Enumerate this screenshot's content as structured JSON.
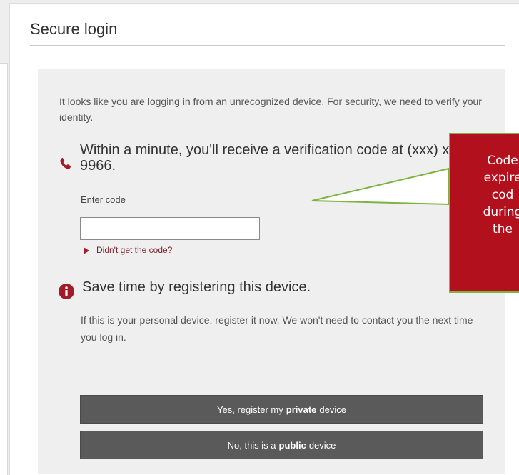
{
  "login": {
    "title": "Secure login",
    "intro": "It looks like you are logging in from an unrecognized device. For security, we need to verify your identity.",
    "verify_heading": "Within a minute, you'll receive a verification code at (xxx) xxx-9966.",
    "enter_code_label": "Enter code",
    "code_value": "",
    "didnt_get_code": "Didn't get the code?",
    "save_heading": "Save time by registering this device.",
    "save_text": "If this is your personal device, register it now. We won't need to contact you the next time you log in.",
    "btn_private_pre": "Yes, register my",
    "btn_private_bold": "private",
    "btn_private_post": "device",
    "btn_public_pre": "No, this is a",
    "btn_public_bold": "public",
    "btn_public_post": "device"
  },
  "annotation": {
    "text": "Code\nexpire\ncod\nduring\nthe",
    "bg_color": "#b3101e",
    "border_color": "#7db33e"
  },
  "icons": {
    "phone": "phone-icon",
    "info": "info-icon",
    "arrow": "caret-right-icon"
  }
}
